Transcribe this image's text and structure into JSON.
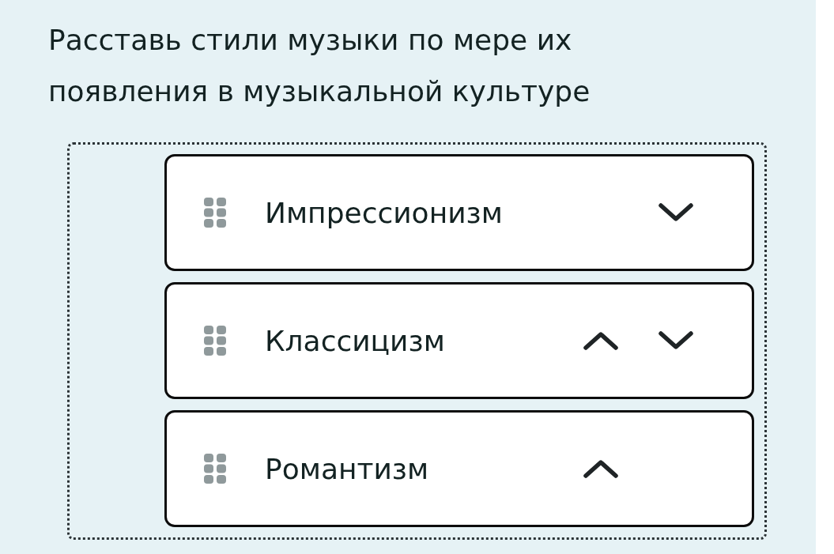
{
  "question": "Расставь стили музыки по мере их появления в музыкальной культуре",
  "items": [
    {
      "label": "Импрессионизм",
      "can_move_up": false,
      "can_move_down": true
    },
    {
      "label": "Классицизм",
      "can_move_up": true,
      "can_move_down": true
    },
    {
      "label": "Романтизм",
      "can_move_up": true,
      "can_move_down": false
    }
  ]
}
